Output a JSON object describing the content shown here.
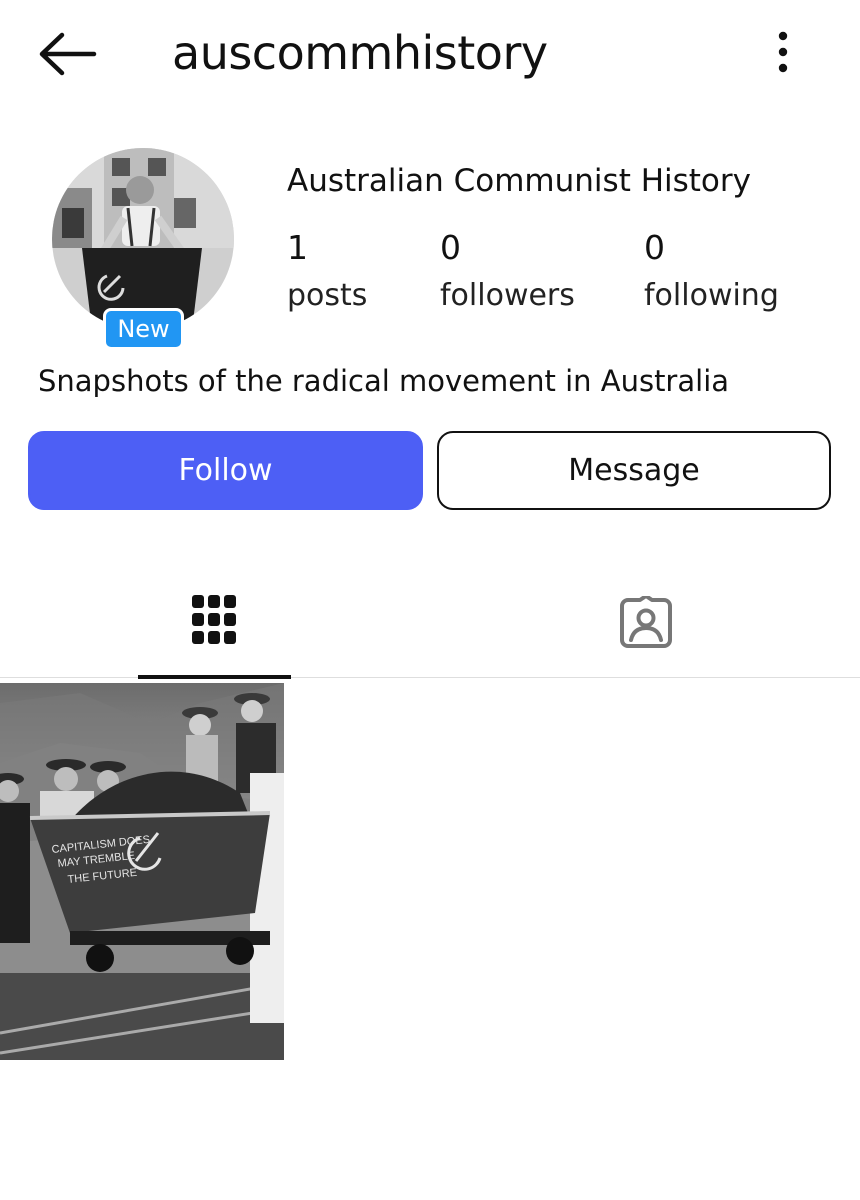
{
  "header": {
    "back_icon": "arrow-left-icon",
    "username": "auscommhistory",
    "more_icon": "more-vertical-icon"
  },
  "profile": {
    "display_name": "Australian Communist History",
    "new_badge": "New",
    "bio": "Snapshots of the radical movement in Australia",
    "stats": {
      "posts": {
        "value": "1",
        "label": "posts"
      },
      "followers": {
        "value": "0",
        "label": "followers"
      },
      "following": {
        "value": "0",
        "label": "following"
      }
    }
  },
  "actions": {
    "follow_label": "Follow",
    "message_label": "Message"
  },
  "tabs": [
    {
      "icon": "grid-icon",
      "active": true
    },
    {
      "icon": "tagged-person-icon",
      "active": false
    }
  ],
  "posts": [
    {
      "image": "black-and-white photo of workers with ore cart"
    }
  ],
  "colors": {
    "follow_button": "#4d5ff5",
    "new_badge": "#2196f3",
    "text": "#111111"
  }
}
